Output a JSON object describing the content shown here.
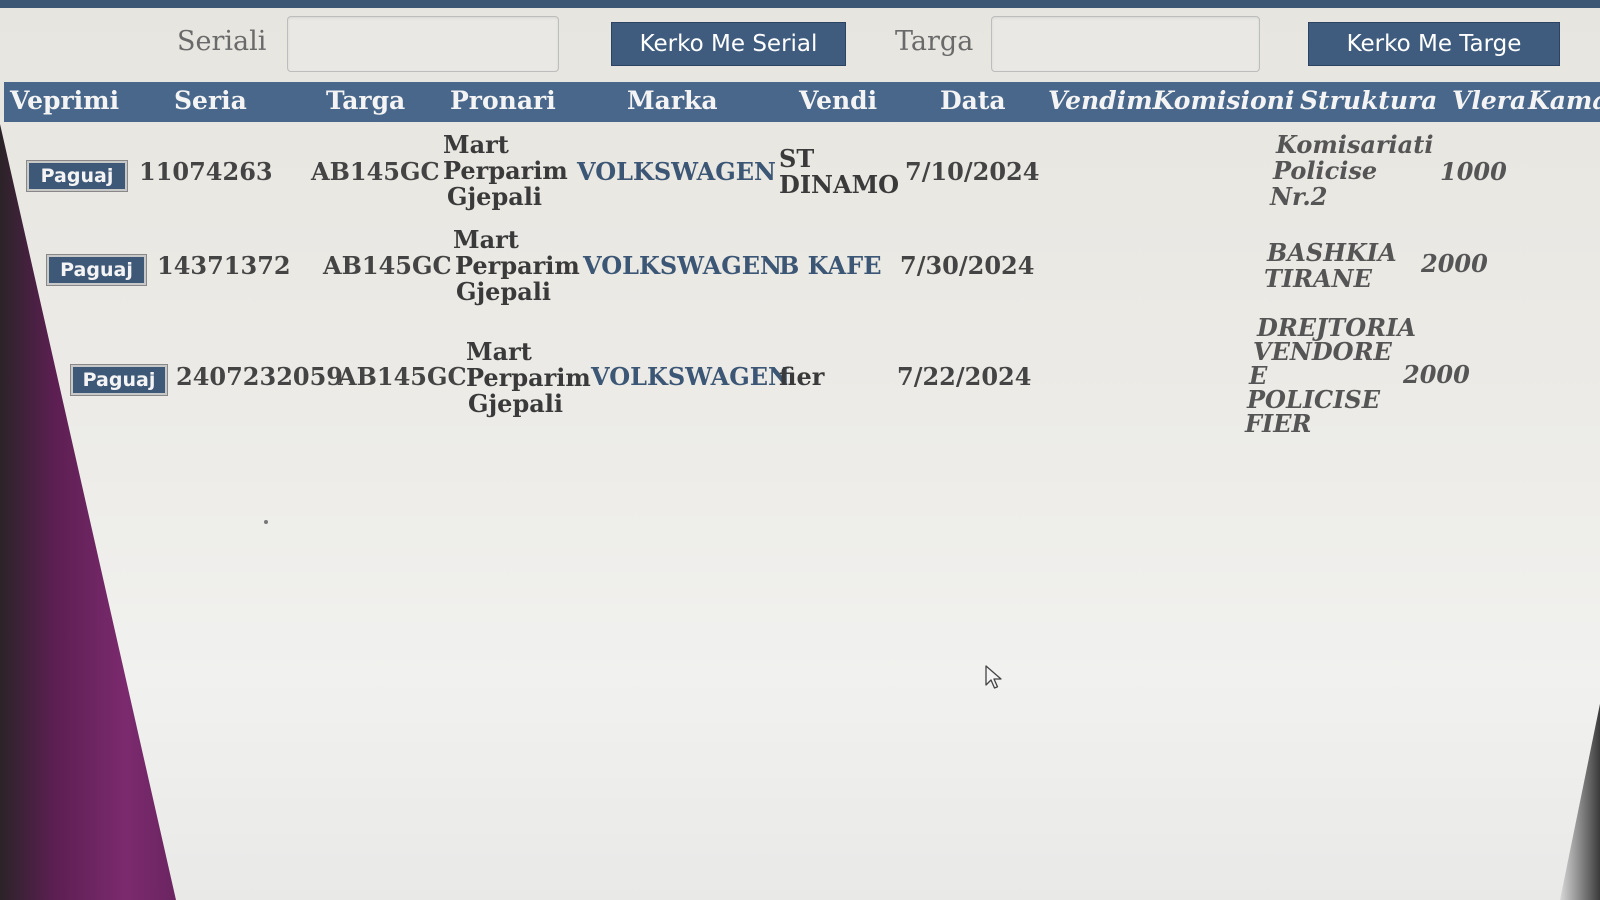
{
  "search": {
    "serial_label": "Seriali",
    "serial_value": "",
    "serial_button": "Kerko Me Serial",
    "plate_label": "Targa",
    "plate_value": "",
    "plate_button": "Kerko Me Targe"
  },
  "table": {
    "headers": [
      "Veprimi",
      "Seria",
      "Targa",
      "Pronari",
      "Marka",
      "Vendi",
      "Data",
      "VendimKomisioni",
      "Struktura",
      "Vlera",
      "Kama"
    ],
    "action_label": "Paguaj",
    "rows": [
      {
        "seria": "11074263",
        "targa": "AB145GC",
        "pronari": [
          "Mart",
          "Perparim",
          "Gjepali"
        ],
        "marka": "VOLKSWAGEN",
        "vendi": [
          "ST",
          "DINAMO"
        ],
        "data": "7/10/2024",
        "vendim": "",
        "struktura": [
          "Komisariati",
          "Policise",
          "Nr.2"
        ],
        "vlera": "1000"
      },
      {
        "seria": "14371372",
        "targa": "AB145GC",
        "pronari": [
          "Mart",
          "Perparim",
          "Gjepali"
        ],
        "marka": "VOLKSWAGEN",
        "vendi": [
          "B KAFE"
        ],
        "data": "7/30/2024",
        "vendim": "",
        "struktura": [
          "BASHKIA",
          "TIRANE"
        ],
        "vlera": "2000"
      },
      {
        "seria": "2407232059",
        "targa": "AB145GC",
        "pronari": [
          "Mart",
          "Perparim",
          "Gjepali"
        ],
        "marka": "VOLKSWAGEN",
        "vendi": [
          "fier"
        ],
        "data": "7/22/2024",
        "vendim": "",
        "struktura": [
          "DREJTORIA",
          "VENDORE",
          "E",
          "POLICISE",
          "FIER"
        ],
        "vlera": "2000"
      }
    ]
  },
  "colors": {
    "header_bg": "#48678b",
    "button_bg": "#3f5c7e",
    "accent_text": "#3c5675"
  },
  "icons": {
    "pointer": "mouse-pointer-icon"
  }
}
